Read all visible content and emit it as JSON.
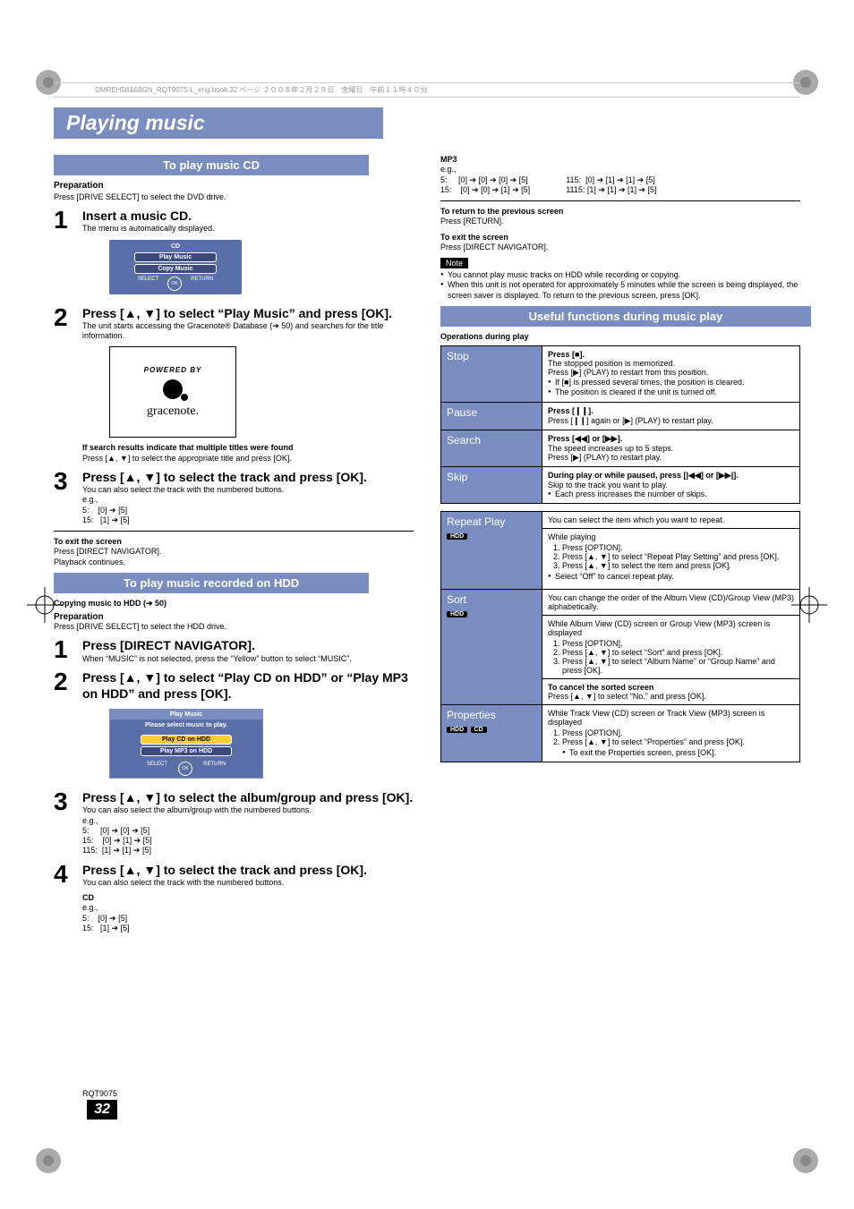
{
  "print_header": "DMREH58&68GN_RQT9075-L_eng.book  32 ページ  ２００８年２月２９日　金曜日　午前１１時４０分",
  "title": "Playing music",
  "left": {
    "section1": "To play music CD",
    "prep_label": "Preparation",
    "prep_text": "Press [DRIVE SELECT] to select the DVD drive.",
    "step1_title": "Insert a music CD.",
    "step1_sub": "The menu is automatically displayed.",
    "cdmenu": {
      "title": "CD",
      "btn1": "Play Music",
      "btn2": "Copy Music",
      "nav_ok": "OK",
      "nav_sel": "SELECT",
      "nav_ret": "RETURN"
    },
    "step2_title": "Press [▲, ▼] to select “Play Music” and press [OK].",
    "step2_sub": "The unit starts accessing the Gracenote® Database (➔ 50) and searches for the title information.",
    "gracenote": {
      "powered": "POWERED BY",
      "name": "gracenote."
    },
    "step2_note1": "If search results indicate that multiple titles were found",
    "step2_note2": "Press [▲, ▼] to select the appropriate title and press [OK].",
    "step3_title": "Press [▲, ▼] to select the track and press [OK].",
    "step3_sub": "You can also select the track with the numbered buttons.",
    "eg": "e.g.,",
    "eg5": "5:",
    "eg5v": "[0] ➔ [5]",
    "eg15": "15:",
    "eg15v": "[1] ➔ [5]",
    "exit_label": "To exit the screen",
    "exit_text1": "Press [DIRECT NAVIGATOR].",
    "exit_text2": "Playback continues.",
    "section2": "To play music recorded on HDD",
    "copy_label": "Copying music to HDD (➔ 50)",
    "prep2_label": "Preparation",
    "prep2_text": "Press [DRIVE SELECT] to select the HDD drive.",
    "h_step1_title": "Press [DIRECT NAVIGATOR].",
    "h_step1_sub": "When “MUSIC” is not selected, press the “Yellow” button to select “MUSIC”.",
    "h_step2_title": "Press [▲, ▼] to select “Play CD on HDD” or “Play MP3 on HDD” and press [OK].",
    "pmmenu": {
      "head": "Play Music",
      "row": "Please select music to play.",
      "btn1": "Play CD on HDD",
      "btn2": "Play MP3 on HDD"
    },
    "h_step3_title": "Press [▲, ▼] to select the album/group and press [OK].",
    "h_step3_sub": "You can also select the album/group with the numbered buttons.",
    "h_eg5v": "[0] ➔ [0] ➔ [5]",
    "h_eg15v": "[0] ➔ [1] ➔ [5]",
    "h_eg115": "115:",
    "h_eg115v": "[1] ➔ [1] ➔ [5]",
    "h_step4_title": "Press [▲, ▼] to select the track and press [OK].",
    "h_step4_sub": "You can also select the track with the numbered buttons.",
    "cd_label": "CD"
  },
  "right": {
    "mp3_label": "MP3",
    "mp3_5v": "[0] ➔ [0] ➔ [0] ➔ [5]",
    "mp3_15v": "[0] ➔ [0] ➔ [1] ➔ [5]",
    "mp3_115": "115:",
    "mp3_115v": "[0] ➔ [1] ➔ [1] ➔ [5]",
    "mp3_1115": "1115:",
    "mp3_1115v": "[1] ➔ [1] ➔ [1] ➔ [5]",
    "return_label": "To return to the previous screen",
    "return_text": "Press [RETURN].",
    "exit_label": "To exit the screen",
    "exit_text": "Press [DIRECT NAVIGATOR].",
    "note_label": "Note",
    "note1": "You cannot play music tracks on HDD while recording or copying.",
    "note2": "When this unit is not operated for approximately 5 minutes while the screen is being displayed, the screen saver is displayed. To return to the previous screen, press [OK].",
    "section": "Useful functions during music play",
    "ops_label": "Operations during play",
    "ops": {
      "stop": {
        "name": "Stop",
        "l1": "Press [■].",
        "l2": "The stopped position is memorized.",
        "l3": "Press [▶] (PLAY) to restart from this position.",
        "b1": "If [■] is pressed several times, the position is cleared.",
        "b2": "The position is cleared if the unit is turned off."
      },
      "pause": {
        "name": "Pause",
        "l1": "Press [❙❙].",
        "l2": "Press [❙❙] again or [▶] (PLAY) to restart play."
      },
      "search": {
        "name": "Search",
        "l1": "Press [◀◀] or [▶▶].",
        "l2": "The speed increases up to 5 steps.",
        "l3": "Press [▶] (PLAY) to restart play."
      },
      "skip": {
        "name": "Skip",
        "l1": "During play or while paused, press [|◀◀] or [▶▶|].",
        "l2": "Skip to the track you want to play.",
        "b1": "Each press increases the number of skips."
      },
      "repeat": {
        "name": "Repeat Play",
        "tag": "HDD",
        "l1": "You can select the item which you want to repeat.",
        "l2": "While playing",
        "s1": "Press [OPTION].",
        "s2": "Press [▲, ▼] to select “Repeat Play Setting” and press [OK].",
        "s3": "Press [▲, ▼] to select the item and press [OK].",
        "b1": "Select “Off” to cancel repeat play."
      },
      "sort": {
        "name": "Sort",
        "tag": "HDD",
        "l1": "You can change the order of the Album View (CD)/Group View (MP3) alphabetically.",
        "l2": "While Album View (CD) screen or Group View (MP3) screen is displayed",
        "s1": "Press [OPTION].",
        "s2": "Press [▲, ▼] to select “Sort” and press [OK].",
        "s3": "Press [▲, ▼] to select “Album Name” or “Group Name” and press [OK].",
        "cancel_t": "To cancel the sorted screen",
        "cancel": "Press [▲, ▼] to select “No.” and press [OK]."
      },
      "props": {
        "name": "Properties",
        "tag1": "HDD",
        "tag2": "CD",
        "l1": "While Track View (CD) screen or Track View (MP3) screen is displayed",
        "s1": "Press [OPTION].",
        "s2": "Press [▲, ▼] to select “Properties” and press [OK].",
        "b1": "To exit the Properties screen, press [OK]."
      }
    }
  },
  "footer": {
    "code": "RQT9075",
    "page": "32"
  }
}
